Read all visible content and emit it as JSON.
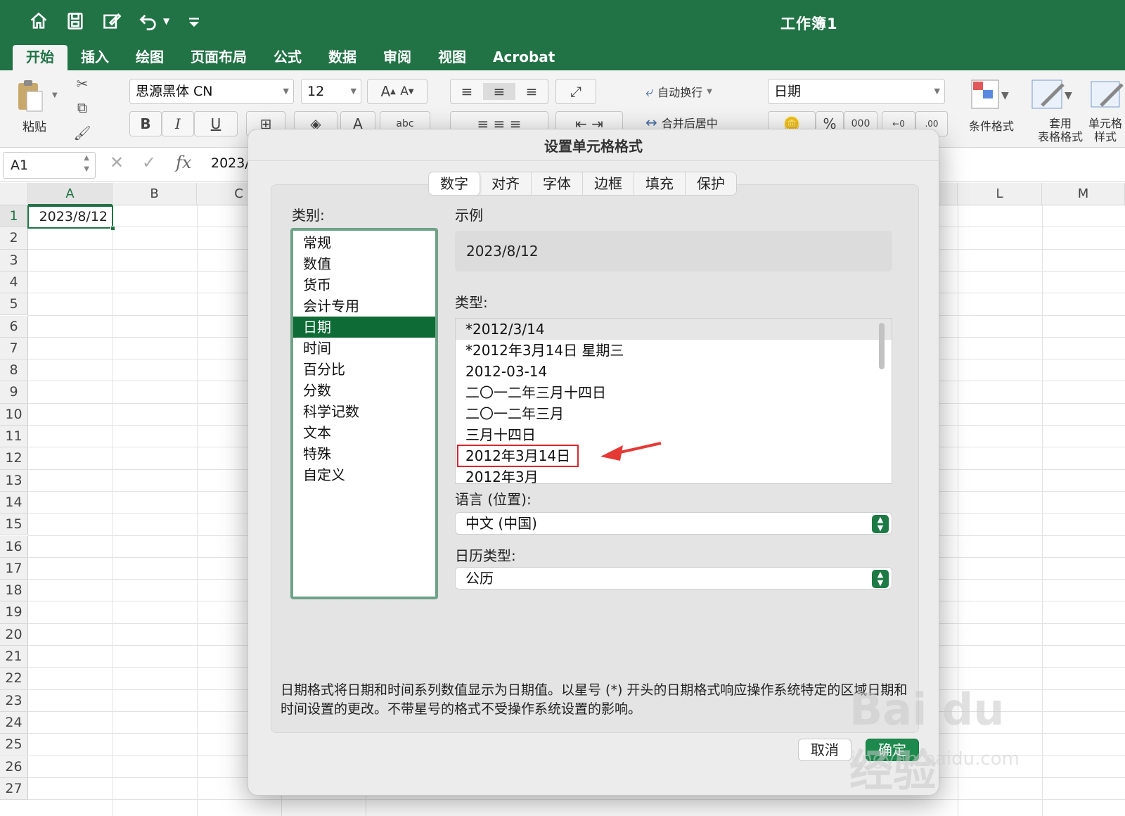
{
  "window": {
    "title": "工作簿1"
  },
  "qat": {
    "icons": [
      "home-icon",
      "save-icon",
      "edit-icon",
      "undo-icon",
      "customize-icon"
    ]
  },
  "tabs": [
    "开始",
    "插入",
    "绘图",
    "页面布局",
    "公式",
    "数据",
    "审阅",
    "视图",
    "Acrobat"
  ],
  "ribbon": {
    "paste_label": "粘贴",
    "font_name": "思源黑体 CN",
    "font_size": "12",
    "bold": "B",
    "italic": "I",
    "underline": "U",
    "grow": "A",
    "shrink": "A",
    "abc": "abc",
    "wrap_text": "自动换行",
    "merge_center": "合并后居中",
    "number_format": "日期",
    "percent": "%",
    "thousands": "000",
    "dec_inc": "0",
    "dec_dec": ".00",
    "cond_format": "条件格式",
    "table_format_l1": "套用",
    "table_format_l2": "表格格式",
    "cell_style_l1": "单元格",
    "cell_style_l2": "样式"
  },
  "formula_bar": {
    "name_box": "A1",
    "formula": "2023/",
    "fx": "fx"
  },
  "grid": {
    "columns": [
      "A",
      "B",
      "C",
      "L",
      "M"
    ],
    "rows": [
      "1",
      "2",
      "3",
      "4",
      "5",
      "6",
      "7",
      "8",
      "9",
      "10",
      "11",
      "12",
      "13",
      "14",
      "15",
      "16",
      "17",
      "18",
      "19",
      "20",
      "21",
      "22",
      "23",
      "24",
      "25",
      "26",
      "27"
    ],
    "a1_value": "2023/8/12"
  },
  "dialog": {
    "title": "设置单元格格式",
    "tabs": [
      "数字",
      "对齐",
      "字体",
      "边框",
      "填充",
      "保护"
    ],
    "active_tab": "数字",
    "category_label": "类别:",
    "categories": [
      "常规",
      "数值",
      "货币",
      "会计专用",
      "日期",
      "时间",
      "百分比",
      "分数",
      "科学记数",
      "文本",
      "特殊",
      "自定义"
    ],
    "selected_category": "日期",
    "sample_label": "示例",
    "sample_value": "2023/8/12",
    "type_label": "类型:",
    "types": [
      "*2012/3/14",
      "*2012年3月14日 星期三",
      "2012-03-14",
      "二〇一二年三月十四日",
      "二〇一二年三月",
      "三月十四日",
      "2012年3月14日",
      "2012年3月"
    ],
    "selected_type": "*2012/3/14",
    "highlighted_type": "2012年3月14日",
    "locale_label": "语言 (位置):",
    "locale_value": "中文 (中国)",
    "calendar_label": "日历类型:",
    "calendar_value": "公历",
    "description": "日期格式将日期和时间系列数值显示为日期值。以星号 (*) 开头的日期格式响应操作系统特定的区域日期和时间设置的更改。不带星号的格式不受操作系统设置的影响。",
    "cancel": "取消",
    "ok": "确定"
  },
  "watermark": {
    "brand": "Bai du 经验",
    "url": "jingyan.baidu.com"
  },
  "colors": {
    "accent": "#217346",
    "selection": "#0e6b35",
    "highlight_box": "#d6282e",
    "annotation_arrow": "#e53935"
  }
}
